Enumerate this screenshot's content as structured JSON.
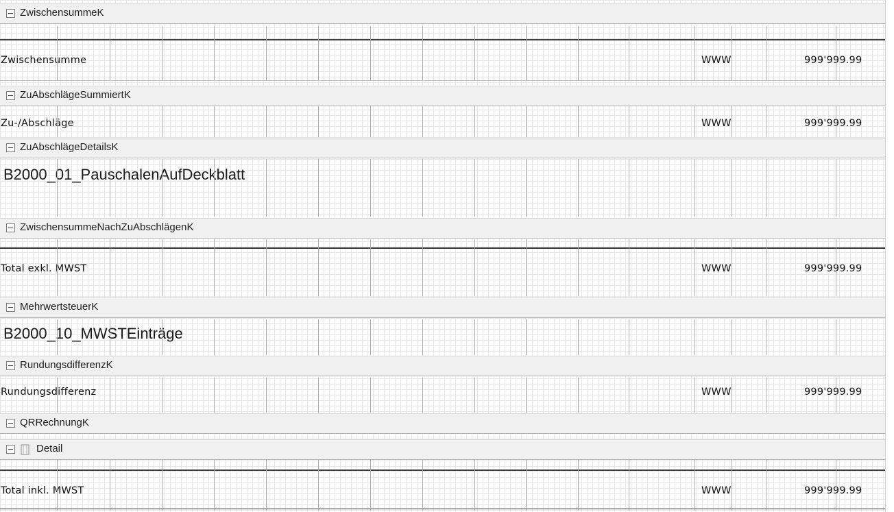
{
  "bands": {
    "zwischensumme_k": {
      "title": "ZwischensummeK",
      "label": "Zwischensumme",
      "currency": "WWW",
      "amount": "999'999.99"
    },
    "zuabschlaege_summiert_k": {
      "title": "ZuAbschlägeSummiertK",
      "label": "Zu-/Abschläge",
      "currency": "WWW",
      "amount": "999'999.99"
    },
    "zuabschlaege_details_k": {
      "title": "ZuAbschlägeDetailsK",
      "subreport": "B2000_01_PauschalenAufDeckblatt"
    },
    "zwischensumme_nach_k": {
      "title": "ZwischensummeNachZuAbschlägenK",
      "label": "Total exkl. MWST",
      "currency": "WWW",
      "amount": "999'999.99"
    },
    "mehrwertsteuer_k": {
      "title": "MehrwertsteuerK",
      "subreport": "B2000_10_MWSTEinträge"
    },
    "rundungsdifferenz_k": {
      "title": "RundungsdifferenzK",
      "label": "Rundungsdifferenz",
      "currency": "WWW",
      "amount": "999'999.99"
    },
    "qrrechnung_k": {
      "title": "QRRechnungK"
    },
    "detail": {
      "title": "Detail",
      "icon": "detail-band-icon",
      "label": "Total inkl. MWST",
      "currency": "WWW",
      "amount": "999'999.99"
    }
  },
  "icons": {
    "toggle": "collapse-toggle-icon"
  }
}
